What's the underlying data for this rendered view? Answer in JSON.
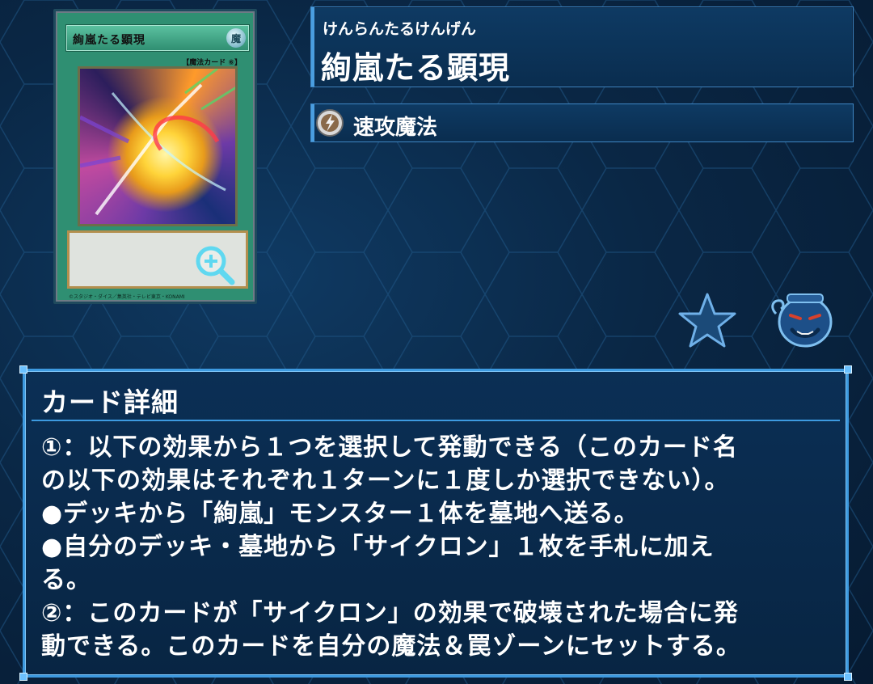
{
  "card_image": {
    "name": "絢嵐たる顕現",
    "attribute": "魔",
    "type_line": "【魔法カード ⑥】",
    "footer": "©スタジオ・ダイス／集英社・テレビ東京・KONAMI"
  },
  "header": {
    "reading": "けんらんたるけんげん",
    "title": "絢嵐たる顕現",
    "spell_type": "速攻魔法"
  },
  "detail": {
    "heading": "カード詳細",
    "lines": [
      "①：以下の効果から１つを選択して発動できる（このカード名",
      "の以下の効果はそれぞれ１ターンに１度しか選択できない）。",
      "●デッキから「絢嵐」モンスター１体を墓地へ送る。",
      "●自分のデッキ・墓地から「サイクロン」１枚を手札に加え",
      "る。",
      "②：このカードが「サイクロン」の効果で破壊された場合に発",
      "動できる。このカードを自分の魔法＆罠ゾーンにセットする。"
    ]
  },
  "icons": {
    "zoom": "zoom-in-icon",
    "spell_type": "quick-play-icon",
    "favorite": "star-icon",
    "deck_pot": "pot-icon"
  },
  "colors": {
    "panel_border": "#3d9ae0",
    "background": "#0a2745",
    "card_frame": "#2f8f72"
  }
}
